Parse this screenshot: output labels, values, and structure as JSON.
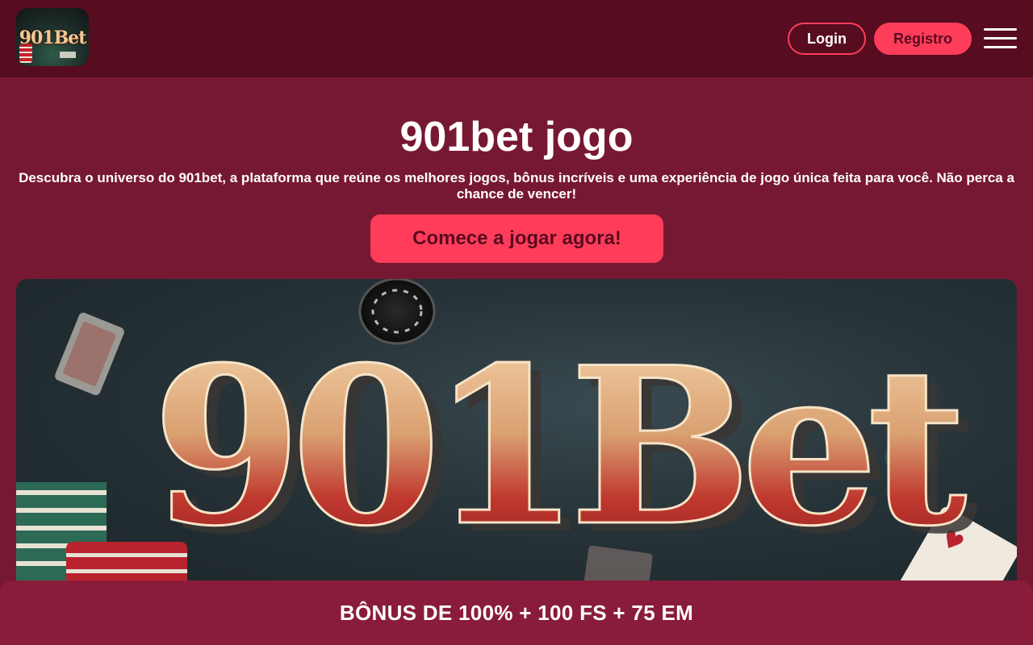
{
  "header": {
    "logo_text": "901Bet",
    "login_label": "Login",
    "register_label": "Registro"
  },
  "hero": {
    "title": "901bet jogo",
    "description": "Descubra o universo do 901bet, a plataforma que reúne os melhores jogos, bônus incríveis e uma experiência de jogo única feita para você. Não perca a chance de vencer!",
    "cta_label": "Comece a jogar agora!"
  },
  "banner": {
    "logo_text": "901Bet"
  },
  "bonus_bar": {
    "text": "BÔNUS DE 100% + 100 FS + 75 EM"
  },
  "colors": {
    "header_bg": "#570c1f",
    "page_bg": "#771833",
    "accent": "#ff3d5a",
    "bonus_bar_bg": "#8a1c3b"
  },
  "icons": {
    "menu": "hamburger-menu-icon"
  }
}
